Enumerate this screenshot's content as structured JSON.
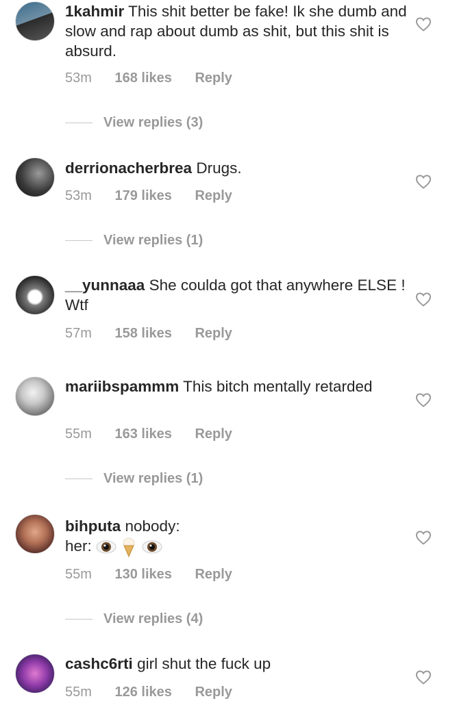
{
  "comments": [
    {
      "user": "1kahmir",
      "text": "This shit better be fake! Ik she dumb and slow and rap about dumb as shit, but this shit is absurd.",
      "time": "53m",
      "likes": "168 likes",
      "reply": "Reply",
      "view_replies": "View replies (3)"
    },
    {
      "user": "derrionacherbrea",
      "text": "Drugs.",
      "time": "53m",
      "likes": "179 likes",
      "reply": "Reply",
      "view_replies": "View replies (1)"
    },
    {
      "user": "__yunnaaa",
      "text": "She coulda got that anywhere ELSE ! Wtf",
      "time": "57m",
      "likes": "158 likes",
      "reply": "Reply",
      "view_replies": ""
    },
    {
      "user": "mariibspammm",
      "text": "This bitch mentally retarded",
      "time": "55m",
      "likes": "163 likes",
      "reply": "Reply",
      "view_replies": "View replies (1)"
    },
    {
      "user": "bihputa",
      "text": "nobody:",
      "text_line2_prefix": "her:",
      "emojis": [
        "eye-emoji",
        "ice-cream-emoji",
        "eye-emoji"
      ],
      "time": "55m",
      "likes": "130 likes",
      "reply": "Reply",
      "view_replies": "View replies (4)"
    },
    {
      "user": "cashc6rti",
      "text": "girl shut the fuck up",
      "time": "55m",
      "likes": "126 likes",
      "reply": "Reply",
      "view_replies": ""
    }
  ],
  "icons": {
    "like": "heart-outline-icon"
  },
  "colors": {
    "meta": "#999999",
    "text": "#262626"
  }
}
